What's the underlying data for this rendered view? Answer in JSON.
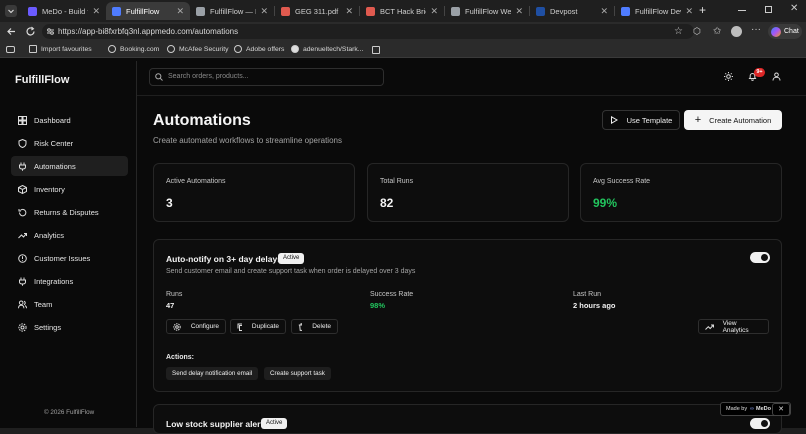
{
  "browser": {
    "tabs": [
      {
        "title": "MeDo - Build full-st",
        "color": "#6b5bff"
      },
      {
        "title": "FulfillFlow",
        "color": "#4f7cff"
      },
      {
        "title": "FulfillFlow — Inven",
        "color": "#9aa0a6"
      },
      {
        "title": "GEG 311.pdf",
        "color": "#e05a4f"
      },
      {
        "title": "BCT Hack Brief.pdf",
        "color": "#e05a4f"
      },
      {
        "title": "FulfillFlow Web App",
        "color": "#9aa0a6"
      },
      {
        "title": "Devpost",
        "color": "#1f4fa3"
      },
      {
        "title": "FulfillFlow Develop",
        "color": "#4f7cff"
      }
    ],
    "url": "https://app-bi8fxrbfq3nl.appmedo.com/automations",
    "chat_label": "Chat",
    "bookmarks": [
      "Import favourites",
      "Booking.com",
      "McAfee Security",
      "Adobe offers",
      "adenueltech/Stark..."
    ]
  },
  "sidebar": {
    "logo": "FulfillFlow",
    "items": [
      {
        "label": "Dashboard",
        "icon": "dashboard-icon"
      },
      {
        "label": "Risk Center",
        "icon": "shield-icon"
      },
      {
        "label": "Automations",
        "icon": "plug-icon"
      },
      {
        "label": "Inventory",
        "icon": "box-icon"
      },
      {
        "label": "Returns & Disputes",
        "icon": "return-icon"
      },
      {
        "label": "Analytics",
        "icon": "trending-icon"
      },
      {
        "label": "Customer Issues",
        "icon": "alert-circle-icon"
      },
      {
        "label": "Integrations",
        "icon": "plug-icon"
      },
      {
        "label": "Team",
        "icon": "users-icon"
      },
      {
        "label": "Settings",
        "icon": "gear-icon"
      }
    ],
    "active_index": 2,
    "copyright": "© 2026 FulfillFlow"
  },
  "topbar": {
    "search_placeholder": "Search orders, products...",
    "notification_count": "9+"
  },
  "page": {
    "title": "Automations",
    "subtitle": "Create automated workflows to streamline operations",
    "use_template_label": "Use Template",
    "create_label": "Create Automation"
  },
  "stats": [
    {
      "label": "Active Automations",
      "value": "3"
    },
    {
      "label": "Total Runs",
      "value": "82"
    },
    {
      "label": "Avg Success Rate",
      "value": "99%"
    }
  ],
  "automations": [
    {
      "title": "Auto-notify on 3+ day delays",
      "status": "Active",
      "description": "Send customer email and create support task when order is delayed over 3 days",
      "runs_label": "Runs",
      "runs": "47",
      "success_label": "Success Rate",
      "success": "98%",
      "last_run_label": "Last Run",
      "last_run": "2 hours ago",
      "buttons": {
        "configure": "Configure",
        "duplicate": "Duplicate",
        "delete": "Delete",
        "analytics": "View Analytics"
      },
      "actions_label": "Actions:",
      "actions": [
        "Send delay notification email",
        "Create support task"
      ]
    },
    {
      "title": "Low stock supplier alerts",
      "status": "Active"
    }
  ],
  "madeby": {
    "prefix": "Made by",
    "brand": "MeDo"
  },
  "colors": {
    "accent_green": "#22c55e",
    "badge_red": "#dc2626"
  }
}
